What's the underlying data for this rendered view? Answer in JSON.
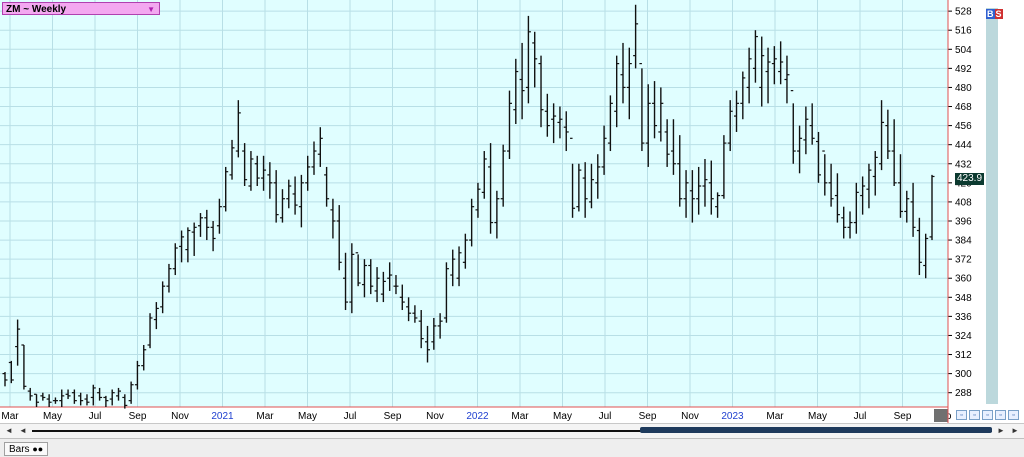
{
  "symbol": {
    "label": "ZM ~ Weekly"
  },
  "badges": {
    "b": "B",
    "s": "S"
  },
  "current_price_label": "423.9",
  "statusbar": {
    "tab_label": "Bars"
  },
  "colors": {
    "background": "#e0feff",
    "grid": "#b8dfe6",
    "bars": "#111111",
    "divider": "#e05050",
    "axis_year": "#2040d0"
  },
  "chart_data": {
    "type": "ohlc",
    "title": "ZM ~ Weekly",
    "grid": true,
    "y_ticks": [
      288,
      300,
      312,
      324,
      336,
      348,
      360,
      372,
      384,
      396,
      408,
      420,
      432,
      444,
      456,
      468,
      480,
      492,
      504,
      516,
      528
    ],
    "ylim": [
      279,
      535
    ],
    "x_tick_labels": [
      {
        "label": "Mar",
        "year": false
      },
      {
        "label": "May",
        "year": false
      },
      {
        "label": "Jul",
        "year": false
      },
      {
        "label": "Sep",
        "year": false
      },
      {
        "label": "Nov",
        "year": false
      },
      {
        "label": "2021",
        "year": true
      },
      {
        "label": "Mar",
        "year": false
      },
      {
        "label": "May",
        "year": false
      },
      {
        "label": "Jul",
        "year": false
      },
      {
        "label": "Sep",
        "year": false
      },
      {
        "label": "Nov",
        "year": false
      },
      {
        "label": "2022",
        "year": true
      },
      {
        "label": "Mar",
        "year": false
      },
      {
        "label": "May",
        "year": false
      },
      {
        "label": "Jul",
        "year": false
      },
      {
        "label": "Sep",
        "year": false
      },
      {
        "label": "Nov",
        "year": false
      },
      {
        "label": "2023",
        "year": true
      },
      {
        "label": "Mar",
        "year": false
      },
      {
        "label": "May",
        "year": false
      },
      {
        "label": "Jul",
        "year": false
      },
      {
        "label": "Sep",
        "year": false
      },
      {
        "label": "No",
        "year": false
      }
    ],
    "last_price": 423.9,
    "bars": [
      [
        300,
        301,
        292,
        296
      ],
      [
        307,
        308,
        294,
        296
      ],
      [
        317,
        334,
        305,
        328
      ],
      [
        318,
        318,
        290,
        292
      ],
      [
        289,
        291,
        283,
        286
      ],
      [
        287,
        287,
        279,
        282
      ],
      [
        286,
        288,
        283,
        285
      ],
      [
        284,
        287,
        279,
        282
      ],
      [
        283,
        285,
        281,
        283
      ],
      [
        283,
        290,
        279,
        286
      ],
      [
        287,
        290,
        284,
        286
      ],
      [
        288,
        290,
        281,
        283
      ],
      [
        286,
        288,
        280,
        283
      ],
      [
        284,
        287,
        280,
        282
      ],
      [
        285,
        293,
        280,
        291
      ],
      [
        288,
        291,
        283,
        285
      ],
      [
        285,
        286,
        279,
        283
      ],
      [
        284,
        290,
        280,
        288
      ],
      [
        286,
        291,
        283,
        289
      ],
      [
        285,
        287,
        278,
        280
      ],
      [
        283,
        295,
        281,
        293
      ],
      [
        293,
        308,
        290,
        305
      ],
      [
        305,
        318,
        302,
        315
      ],
      [
        318,
        338,
        316,
        335
      ],
      [
        334,
        345,
        328,
        341
      ],
      [
        342,
        358,
        338,
        355
      ],
      [
        355,
        369,
        351,
        366
      ],
      [
        366,
        382,
        362,
        379
      ],
      [
        380,
        390,
        370,
        386
      ],
      [
        378,
        392,
        370,
        390
      ],
      [
        389,
        395,
        374,
        392
      ],
      [
        393,
        401,
        386,
        398
      ],
      [
        398,
        403,
        384,
        392
      ],
      [
        392,
        396,
        377,
        385
      ],
      [
        393,
        410,
        388,
        405
      ],
      [
        405,
        430,
        402,
        427
      ],
      [
        425,
        447,
        422,
        442
      ],
      [
        440,
        472,
        436,
        464
      ],
      [
        440,
        445,
        418,
        422
      ],
      [
        418,
        440,
        415,
        435
      ],
      [
        432,
        437,
        418,
        423
      ],
      [
        423,
        437,
        415,
        428
      ],
      [
        425,
        433,
        410,
        420
      ],
      [
        420,
        428,
        395,
        400
      ],
      [
        398,
        416,
        395,
        410
      ],
      [
        410,
        422,
        404,
        418
      ],
      [
        413,
        424,
        400,
        406
      ],
      [
        405,
        425,
        392,
        420
      ],
      [
        420,
        437,
        415,
        430
      ],
      [
        430,
        446,
        425,
        440
      ],
      [
        438,
        455,
        430,
        448
      ],
      [
        425,
        430,
        405,
        410
      ],
      [
        403,
        410,
        385,
        396
      ],
      [
        396,
        406,
        365,
        370
      ],
      [
        360,
        376,
        340,
        345
      ],
      [
        345,
        382,
        338,
        375
      ],
      [
        376,
        375,
        355,
        357
      ],
      [
        356,
        372,
        348,
        368
      ],
      [
        368,
        372,
        350,
        355
      ],
      [
        352,
        367,
        345,
        360
      ],
      [
        350,
        364,
        345,
        358
      ],
      [
        360,
        370,
        352,
        362
      ],
      [
        355,
        362,
        350,
        355
      ],
      [
        348,
        356,
        340,
        345
      ],
      [
        342,
        348,
        333,
        338
      ],
      [
        338,
        343,
        332,
        335
      ],
      [
        333,
        340,
        316,
        322
      ],
      [
        320,
        330,
        307,
        315
      ],
      [
        320,
        335,
        315,
        330
      ],
      [
        330,
        338,
        322,
        333
      ],
      [
        335,
        370,
        332,
        366
      ],
      [
        362,
        378,
        355,
        372
      ],
      [
        360,
        380,
        355,
        376
      ],
      [
        370,
        388,
        366,
        384
      ],
      [
        384,
        410,
        380,
        405
      ],
      [
        403,
        420,
        398,
        416
      ],
      [
        414,
        440,
        410,
        435
      ],
      [
        430,
        445,
        388,
        395
      ],
      [
        395,
        415,
        385,
        410
      ],
      [
        410,
        444,
        405,
        440
      ],
      [
        440,
        478,
        435,
        470
      ],
      [
        466,
        498,
        457,
        490
      ],
      [
        485,
        508,
        460,
        478
      ],
      [
        480,
        525,
        470,
        515
      ],
      [
        508,
        515,
        480,
        498
      ],
      [
        495,
        500,
        455,
        466
      ],
      [
        465,
        476,
        449,
        456
      ],
      [
        460,
        470,
        445,
        462
      ],
      [
        458,
        468,
        448,
        460
      ],
      [
        455,
        465,
        440,
        452
      ],
      [
        448,
        432,
        398,
        404
      ],
      [
        405,
        432,
        402,
        428
      ],
      [
        423,
        433,
        398,
        410
      ],
      [
        408,
        432,
        404,
        422
      ],
      [
        420,
        438,
        410,
        430
      ],
      [
        430,
        456,
        425,
        448
      ],
      [
        445,
        475,
        440,
        470
      ],
      [
        465,
        500,
        455,
        495
      ],
      [
        488,
        508,
        470,
        480
      ],
      [
        480,
        505,
        460,
        495
      ],
      [
        500,
        532,
        492,
        520
      ],
      [
        495,
        492,
        440,
        445
      ],
      [
        445,
        482,
        430,
        470
      ],
      [
        470,
        484,
        448,
        456
      ],
      [
        452,
        480,
        446,
        470
      ],
      [
        452,
        460,
        430,
        438
      ],
      [
        440,
        460,
        425,
        432
      ],
      [
        432,
        450,
        405,
        410
      ],
      [
        410,
        428,
        398,
        420
      ],
      [
        415,
        428,
        395,
        410
      ],
      [
        410,
        430,
        400,
        418
      ],
      [
        418,
        435,
        405,
        422
      ],
      [
        420,
        434,
        400,
        410
      ],
      [
        405,
        414,
        398,
        412
      ],
      [
        412,
        450,
        410,
        445
      ],
      [
        445,
        472,
        440,
        465
      ],
      [
        462,
        478,
        452,
        470
      ],
      [
        470,
        490,
        460,
        486
      ],
      [
        480,
        505,
        470,
        498
      ],
      [
        492,
        516,
        483,
        512
      ],
      [
        480,
        512,
        468,
        500
      ],
      [
        490,
        505,
        470,
        496
      ],
      [
        495,
        506,
        482,
        498
      ],
      [
        490,
        509,
        482,
        496
      ],
      [
        485,
        500,
        470,
        488
      ],
      [
        478,
        470,
        432,
        440
      ],
      [
        440,
        456,
        426,
        448
      ],
      [
        447,
        468,
        438,
        460
      ],
      [
        456,
        470,
        444,
        448
      ],
      [
        446,
        452,
        420,
        425
      ],
      [
        440,
        438,
        412,
        420
      ],
      [
        420,
        432,
        405,
        410
      ],
      [
        412,
        426,
        395,
        400
      ],
      [
        398,
        405,
        385,
        392
      ],
      [
        392,
        402,
        385,
        395
      ],
      [
        395,
        420,
        388,
        414
      ],
      [
        412,
        424,
        400,
        418
      ],
      [
        416,
        432,
        404,
        428
      ],
      [
        424,
        440,
        412,
        436
      ],
      [
        432,
        472,
        428,
        458
      ],
      [
        456,
        466,
        435,
        440
      ],
      [
        440,
        460,
        418,
        420
      ],
      [
        420,
        438,
        398,
        402
      ],
      [
        402,
        415,
        395,
        410
      ],
      [
        408,
        420,
        386,
        392
      ],
      [
        390,
        398,
        362,
        370
      ],
      [
        368,
        388,
        360,
        385
      ],
      [
        386,
        425,
        384,
        424
      ]
    ]
  }
}
